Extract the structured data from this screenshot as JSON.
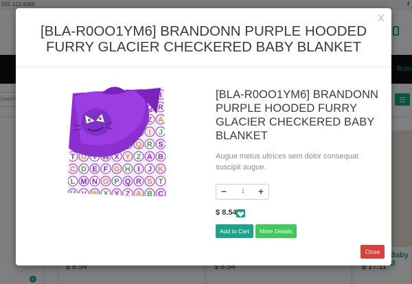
{
  "background": {
    "phone": "555 123 8069",
    "facebook_glyph": "f",
    "nav_brand": "Bran",
    "search_placeholder": "Search",
    "prices": [
      "$ 8.54",
      "$ 8.54",
      "$ 17.11"
    ],
    "card_title": "Baby B"
  },
  "modal": {
    "close_x": "X",
    "title": "[BLA-R0OO1YM6] BRANDONN PURPLE HOODED FURRY GLACIER CHECKERED BABY BLANKET",
    "product_title": "[BLA-R0OO1YM6] BRANDONN PURPLE HOODED FURRY GLACIER CHECKERED BABY BLANKET",
    "description": "Augue metus ultrices sem dolor consequat suscipit augue.",
    "quantity": "1",
    "qty_minus": "−",
    "qty_plus": "+",
    "price": "$ 8.54",
    "add_to_cart": "Add to Cart",
    "more_details": "More Details",
    "close_button": "Close"
  },
  "colors": {
    "accent": "#18a58a",
    "details": "#3ec95a",
    "danger": "#d9413a"
  },
  "icons": [
    "close-icon",
    "minus-icon",
    "plus-icon",
    "heart-icon",
    "phone-icon",
    "menu-icon",
    "facebook-icon"
  ]
}
